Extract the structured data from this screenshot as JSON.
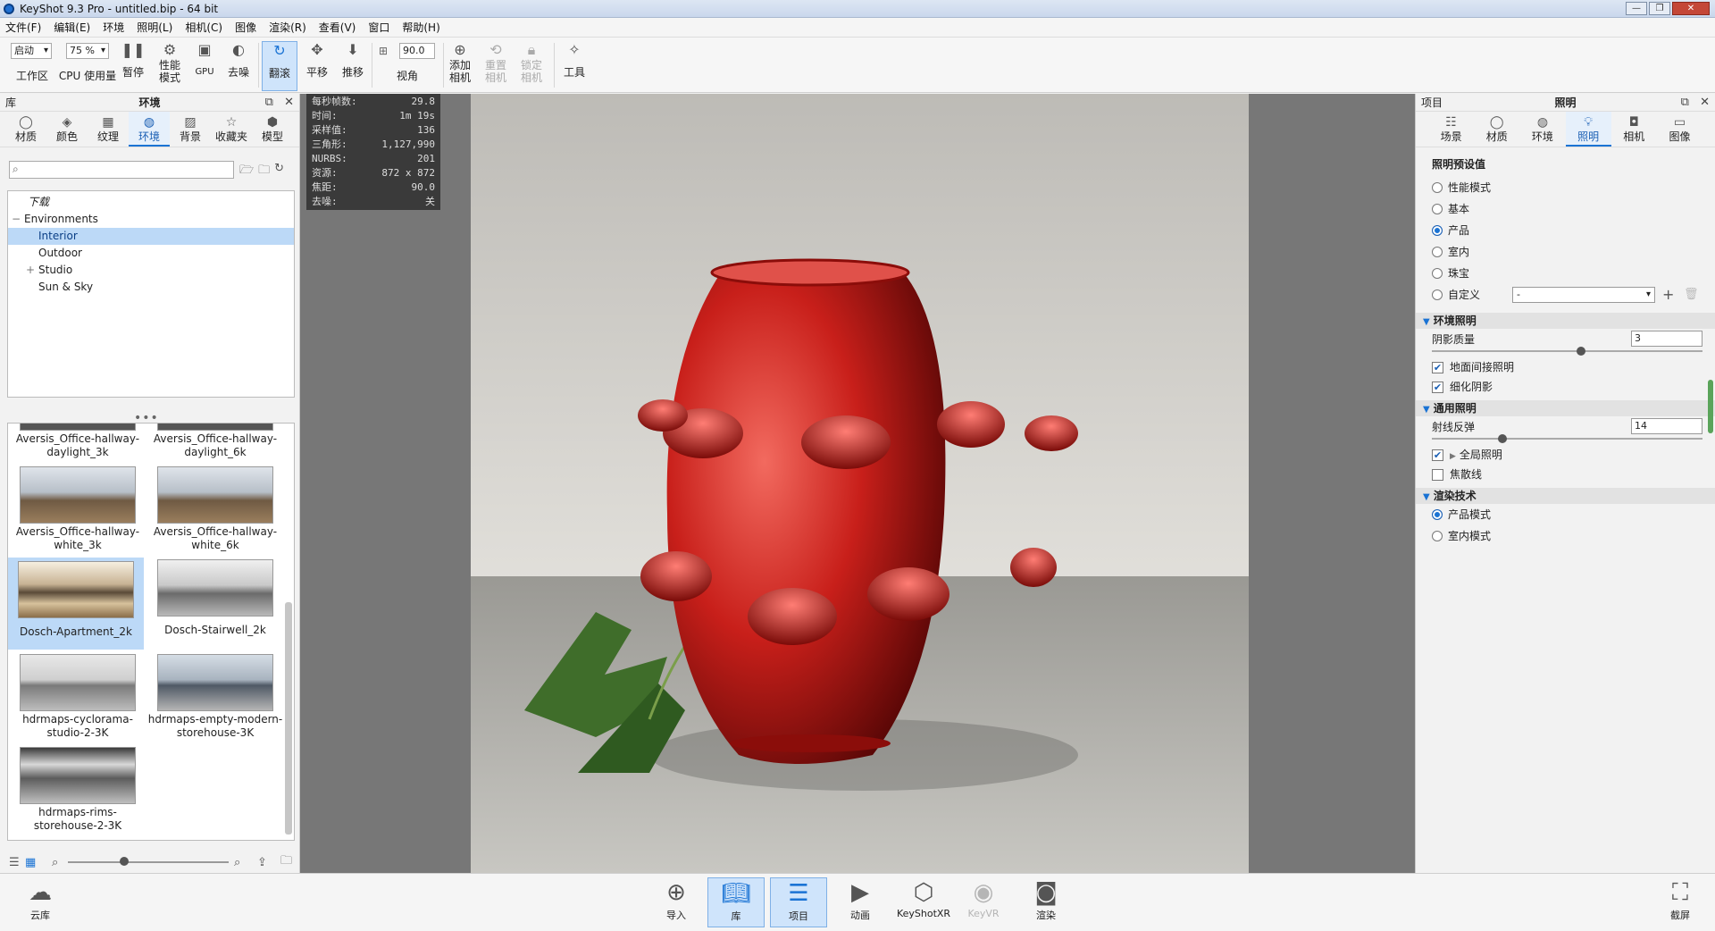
{
  "window": {
    "title": "KeyShot 9.3 Pro  - untitled.bip  - 64 bit",
    "controls": [
      "—",
      "❐",
      "✕"
    ]
  },
  "menu": [
    "文件(F)",
    "编辑(E)",
    "环境",
    "照明(L)",
    "相机(C)",
    "图像",
    "渲染(R)",
    "查看(V)",
    "窗口",
    "帮助(H)"
  ],
  "toolbar": {
    "workspace_select": "启动",
    "workspace_label": "工作区",
    "cpu_select": "75 %",
    "cpu_label": "CPU 使用量",
    "pause": "暂停",
    "performance": "性能\n模式",
    "gpu": "GPU",
    "denoise": "去噪",
    "tumble": "翻滚",
    "pan": "平移",
    "dolly": "推移",
    "fov_value": "90.0",
    "fov_label": "视角",
    "add_camera": "添加\n相机",
    "reset_camera": "重置\n相机",
    "lock_camera": "锁定\n相机",
    "tools": "工具"
  },
  "library": {
    "header_left": "库",
    "header_title": "环境",
    "tabs": [
      "材质",
      "颜色",
      "纹理",
      "环境",
      "背景",
      "收藏夹",
      "模型"
    ],
    "active_tab": "环境",
    "search_placeholder": "",
    "tree": {
      "download": "下载",
      "environments": "Environments",
      "interior": "Interior",
      "outdoor": "Outdoor",
      "studio": "Studio",
      "sunsky": "Sun & Sky"
    },
    "thumbnails": [
      {
        "name": "Aversis_Office-hallway-daylight_3k"
      },
      {
        "name": "Aversis_Office-hallway-daylight_6k"
      },
      {
        "name": "Aversis_Office-hallway-white_3k"
      },
      {
        "name": "Aversis_Office-hallway-white_6k"
      },
      {
        "name": "Dosch-Apartment_2k"
      },
      {
        "name": "Dosch-Stairwell_2k"
      },
      {
        "name": "hdrmaps-cyclorama-studio-2-3K"
      },
      {
        "name": "hdrmaps-empty-modern-storehouse-3K"
      },
      {
        "name": "hdrmaps-rims-storehouse-2-3K"
      }
    ]
  },
  "stats": [
    {
      "label": "每秒帧数:",
      "value": "29.8"
    },
    {
      "label": "时间:",
      "value": "1m 19s"
    },
    {
      "label": "采样值:",
      "value": "136"
    },
    {
      "label": "三角形:",
      "value": "1,127,990"
    },
    {
      "label": "NURBS:",
      "value": "201"
    },
    {
      "label": "资源:",
      "value": "872 x 872"
    },
    {
      "label": "焦距:",
      "value": "90.0"
    },
    {
      "label": "去噪:",
      "value": "关"
    }
  ],
  "project": {
    "header_left": "项目",
    "header_title": "照明",
    "tabs": [
      "场景",
      "材质",
      "环境",
      "照明",
      "相机",
      "图像"
    ],
    "active_tab": "照明",
    "presets_title": "照明预设值",
    "presets": [
      "性能模式",
      "基本",
      "产品",
      "室内",
      "珠宝",
      "自定义"
    ],
    "selected_preset": "产品",
    "custom_value": "-",
    "env_section": "环境照明",
    "shadow_quality_label": "阴影质量",
    "shadow_quality_value": "3",
    "shadow_quality_level": 0.55,
    "ground_indirect": "地面间接照明",
    "fine_shadow": "细化阴影",
    "general_section": "通用照明",
    "ray_bounces_label": "射线反弹",
    "ray_bounces_value": "14",
    "ray_bounces_level": 0.25,
    "global_illumination": "全局照明",
    "caustics": "焦散线",
    "render_section": "渲染技术",
    "render_modes": [
      "产品模式",
      "室内模式"
    ],
    "selected_mode": "产品模式"
  },
  "dock": {
    "cloud": "云库",
    "import": "导入",
    "library": "库",
    "project": "项目",
    "animation": "动画",
    "keyshotxr": "KeyShotXR",
    "keyvr": "KeyVR",
    "render": "渲染",
    "screenshot": "截屏"
  }
}
